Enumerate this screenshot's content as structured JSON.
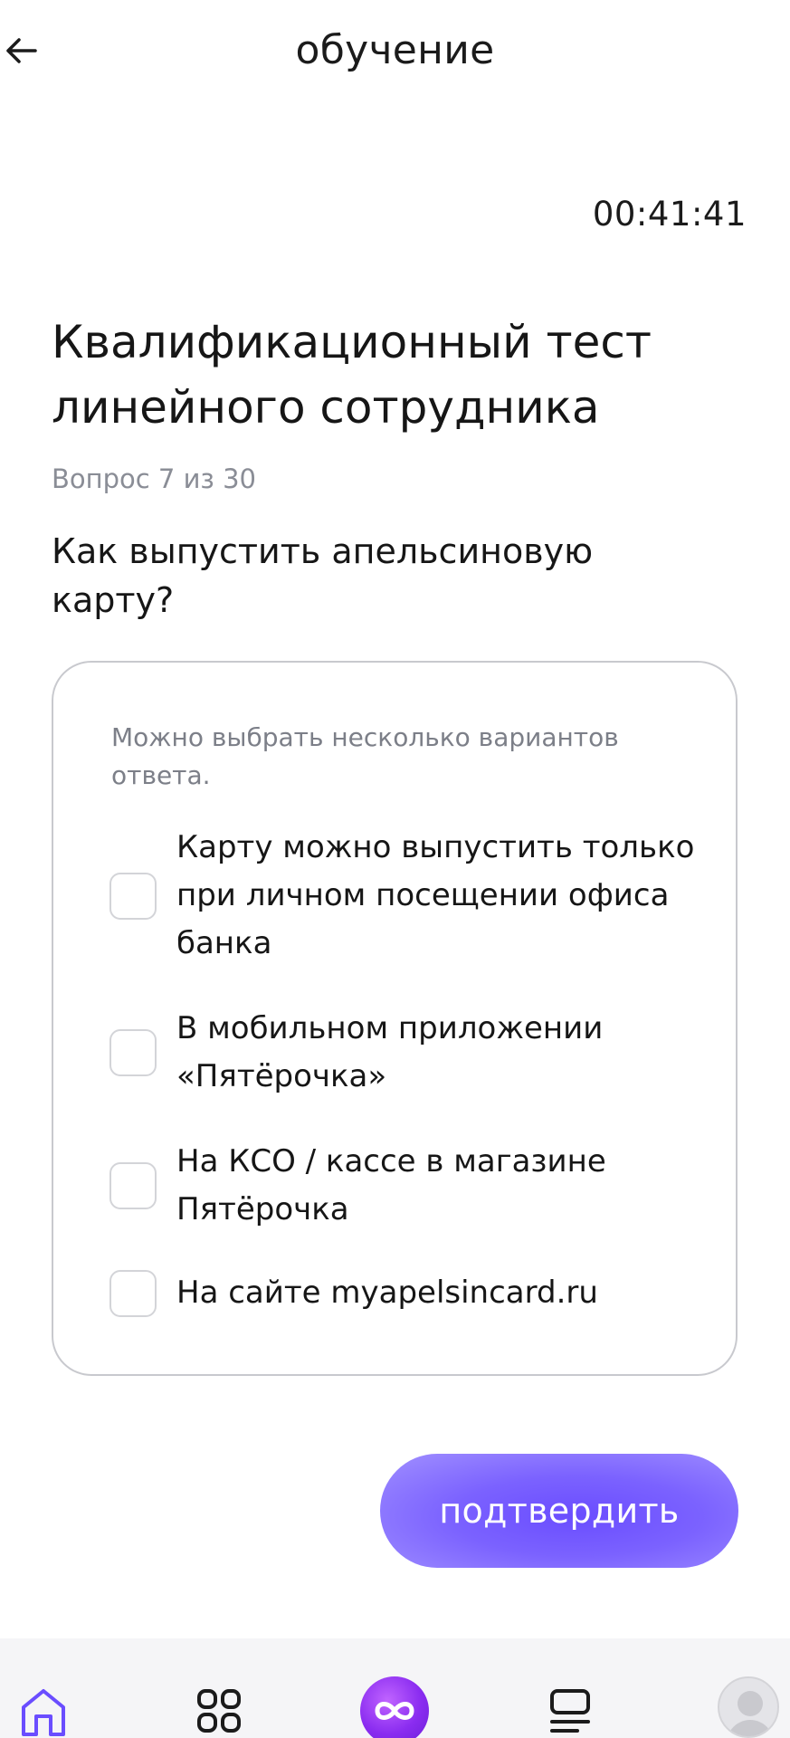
{
  "header": {
    "title": "обучение",
    "back_icon": "arrow-left-icon"
  },
  "timer": "00:41:41",
  "test": {
    "title": "Квалификационный тест линейного сотрудника",
    "counter": "Вопрос 7 из 30",
    "question": "Как выпустить апельсиновую карту?"
  },
  "answers": {
    "hint": "Можно выбрать несколько вариантов ответа.",
    "options": [
      {
        "label": "Карту можно выпустить только при личном посещении офиса банка",
        "checked": false
      },
      {
        "label": "В мобильном приложении «Пятёрочка»",
        "checked": false
      },
      {
        "label": "На КСО / кассе в магазине Пятёрочка",
        "checked": false
      },
      {
        "label": "На сайте myapelsincard.ru",
        "checked": false
      }
    ]
  },
  "confirm_button": {
    "label": "подтвердить"
  },
  "bottom_nav": {
    "items": [
      {
        "icon": "home-icon",
        "active": true
      },
      {
        "icon": "grid-icon",
        "active": false
      },
      {
        "icon": "infinity-icon",
        "active": false
      },
      {
        "icon": "history-icon",
        "active": false
      },
      {
        "icon": "avatar-icon",
        "active": false
      }
    ]
  },
  "colors": {
    "accent": "#6f55ff",
    "text": "#161616",
    "muted": "#8a8d96",
    "border": "#c8c9ce"
  }
}
